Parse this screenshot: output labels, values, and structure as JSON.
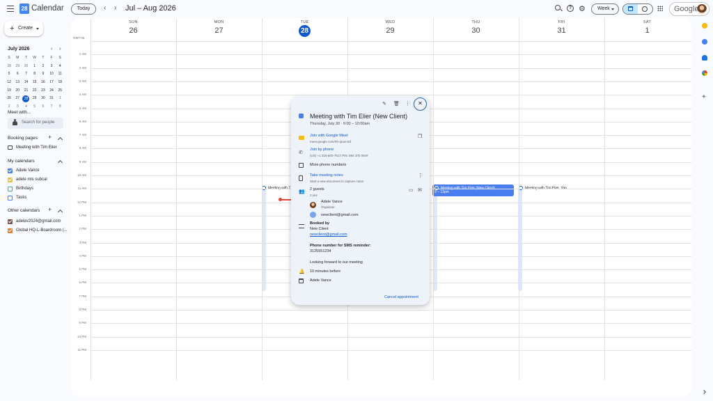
{
  "header": {
    "app_title": "Calendar",
    "logo_text": "28",
    "today_label": "Today",
    "date_range": "Jul – Aug 2026",
    "view_select": "Week",
    "account_word": "Google"
  },
  "sidebar": {
    "create_label": "Create",
    "mini_month": "July 2026",
    "mini_days": [
      "S",
      "M",
      "T",
      "W",
      "T",
      "F",
      "S"
    ],
    "mini_weeks": [
      [
        "28",
        "29",
        "30",
        "1",
        "2",
        "3",
        "4"
      ],
      [
        "5",
        "6",
        "7",
        "8",
        "9",
        "10",
        "11"
      ],
      [
        "12",
        "13",
        "14",
        "15",
        "16",
        "17",
        "18"
      ],
      [
        "19",
        "20",
        "21",
        "22",
        "23",
        "24",
        "25"
      ],
      [
        "26",
        "27",
        "28",
        "29",
        "30",
        "31",
        "1"
      ],
      [
        "2",
        "3",
        "4",
        "5",
        "6",
        "7",
        "8"
      ]
    ],
    "meet_with": "Meet with...",
    "search_people": "Search for people",
    "booking_pages": "Booking pages",
    "booking_item": "Meeting with Tim Elier",
    "my_calendars": "My calendars",
    "my_calendar_items": [
      {
        "label": "Adele Vance",
        "color": "#4a7ef0",
        "checked": true
      },
      {
        "label": "adele mls subcal",
        "color": "#e4c441",
        "checked": true
      },
      {
        "label": "Birthdays",
        "color": "#33b679",
        "checked": false
      },
      {
        "label": "Tasks",
        "color": "#4285f4",
        "checked": false
      }
    ],
    "other_calendars": "Other calendars",
    "other_calendar_items": [
      {
        "label": "adelev2024@gmail.com",
        "color": "#795548",
        "checked": true
      },
      {
        "label": "Global HQ-L-Boardroom (...",
        "color": "#e67c22",
        "checked": true
      }
    ]
  },
  "calendar": {
    "timezone": "GMT-05",
    "days": [
      {
        "name": "SUN",
        "num": "26"
      },
      {
        "name": "MON",
        "num": "27"
      },
      {
        "name": "TUE",
        "num": "28",
        "today": true
      },
      {
        "name": "WED",
        "num": "29"
      },
      {
        "name": "THU",
        "num": "30"
      },
      {
        "name": "FRI",
        "num": "31"
      },
      {
        "name": "SAT",
        "num": "1"
      }
    ],
    "hours": [
      "1 AM",
      "2 AM",
      "3 AM",
      "4 AM",
      "5 AM",
      "6 AM",
      "7 AM",
      "8 AM",
      "9 AM",
      "10 AM",
      "11 AM",
      "12 PM",
      "1 PM",
      "2 PM",
      "3 PM",
      "4 PM",
      "5 PM",
      "6 PM",
      "7 PM",
      "8 PM",
      "9 PM",
      "10 PM",
      "11 PM"
    ],
    "events": {
      "tue": "Meeting with T",
      "thu_title": "Meeting with Tim Elier (New Client)",
      "thu_time": "9 – 12pm",
      "fri": "Meeting with Tim Elier, Yan"
    }
  },
  "popup": {
    "title": "Meeting with Tim Elier (New Client)",
    "when": "Thursday, July 30  ·  9:00 – 10:00am",
    "meet_link": "Join with Google Meet",
    "meet_url": "meet.google.com/rth-qnun-taf",
    "phone_link": "Join by phone",
    "phone_number": "(US) +1 316-500-7517 PIN: 884 375 064#",
    "more_phones": "More phone numbers",
    "notes_link": "Take meeting notes",
    "notes_sub": "Start a new document to capture notes",
    "guests_count": "2 guests",
    "guests_yes": "2 yes",
    "guest1_name": "Adele Vance",
    "guest1_role": "Organizer",
    "guest2_email": "newclient@gmail.com",
    "booked_by_label": "Booked by",
    "booked_by_name": "New Client",
    "booked_by_email": "newclient@gmail.com",
    "sms_label": "Phone number for SMS reminder:",
    "sms_number": "3125551234",
    "message": "Looking forward to our meeting",
    "reminder": "10 minutes before",
    "owner": "Adele Vance",
    "cancel_label": "Cancel appointment",
    "event_color": "#4a7ef0"
  },
  "icons": [
    "hamburger-icon",
    "search-icon",
    "help-icon",
    "gear-icon",
    "apps-icon",
    "edit-icon",
    "delete-icon",
    "more-icon",
    "close-icon",
    "meet-icon",
    "phone-icon",
    "notes-icon",
    "guests-icon",
    "description-icon",
    "bell-icon",
    "calendar-icon",
    "chat-icon",
    "mail-icon",
    "copy-icon"
  ]
}
